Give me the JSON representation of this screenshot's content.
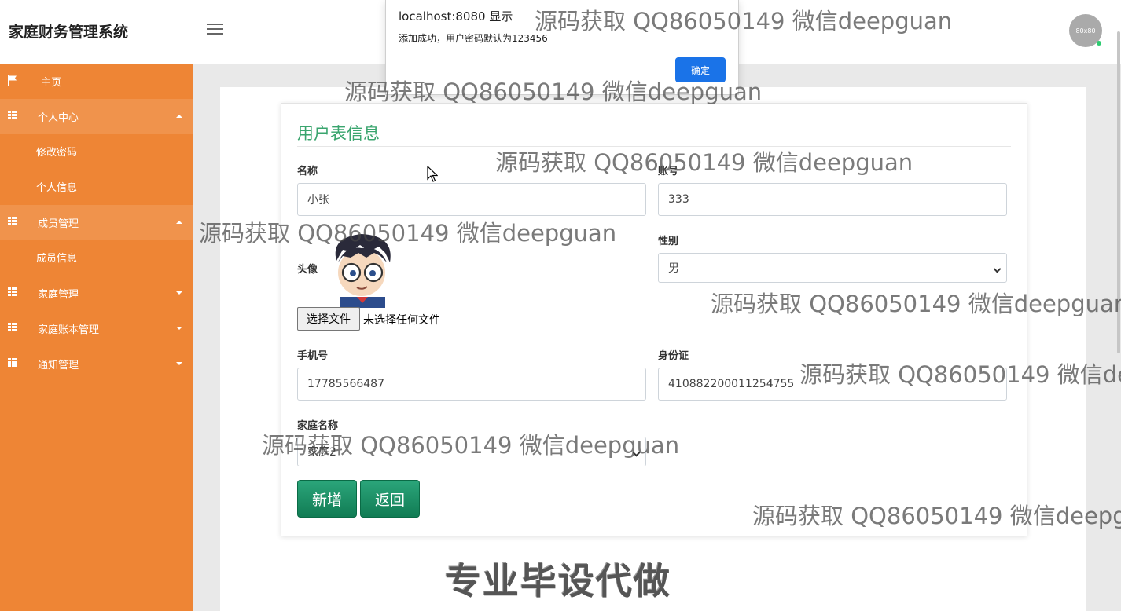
{
  "header": {
    "app_title": "家庭财务管理系统",
    "avatar_text": "80x80"
  },
  "sidebar": {
    "home": "主页",
    "personal_center": {
      "label": "个人中心",
      "items": [
        "修改密码",
        "个人信息"
      ]
    },
    "member_management": {
      "label": "成员管理",
      "items": [
        "成员信息"
      ]
    },
    "family_management": "家庭管理",
    "family_ledger_management": "家庭账本管理",
    "notice_management": "通知管理"
  },
  "form": {
    "title": "用户表信息",
    "name": {
      "label": "名称",
      "value": "小张"
    },
    "account": {
      "label": "账号",
      "value": "333"
    },
    "avatar": {
      "label": "头像",
      "file_button": "选择文件",
      "file_status": "未选择任何文件"
    },
    "gender": {
      "label": "性别",
      "value": "男"
    },
    "phone": {
      "label": "手机号",
      "value": "17785566487"
    },
    "id_card": {
      "label": "身份证",
      "value": "410882200011254755"
    },
    "family_name": {
      "label": "家庭名称",
      "value": "家庭2"
    },
    "add_button": "新增",
    "back_button": "返回"
  },
  "dialog": {
    "title": "localhost:8080 显示",
    "message": "添加成功，用户密码默认为123456",
    "ok_button": "确定"
  },
  "watermark": {
    "text": "源码获取 QQ86050149 微信deepguan",
    "stamp": "专业毕设代做"
  },
  "colors": {
    "sidebar": "#ee8535",
    "title_green": "#3aa56e",
    "button_green": "#117c54",
    "dialog_button": "#1a73e8"
  }
}
